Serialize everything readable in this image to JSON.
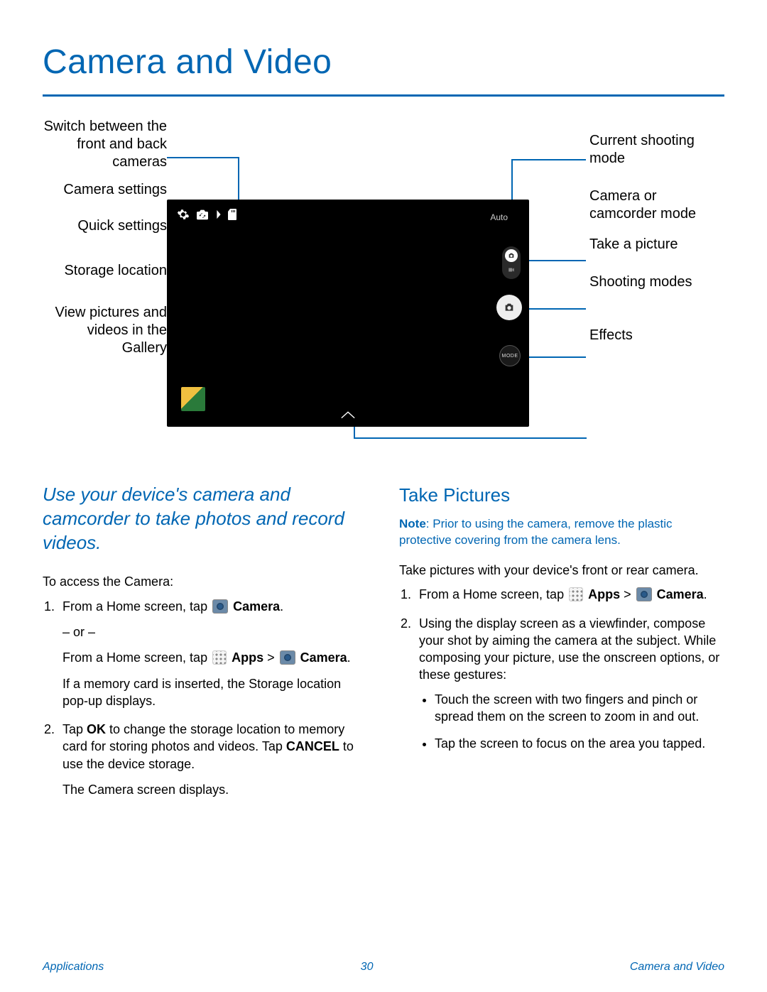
{
  "title": "Camera and Video",
  "labels_left": {
    "switch": "Switch between the front and back cameras",
    "settings": "Camera settings",
    "quick": "Quick settings",
    "storage": "Storage location",
    "gallery": "View pictures and videos in the Gallery"
  },
  "labels_right": {
    "cur_mode": "Current shooting mode",
    "cam_mode": "Camera or camcorder mode",
    "take": "Take a picture",
    "shoot": "Shooting modes",
    "effects": "Effects"
  },
  "screenshot": {
    "auto": "Auto",
    "mode_btn": "MODE"
  },
  "intro": "Use your device's camera and camcorder to take photos and record videos.",
  "access_heading": "To access the Camera:",
  "steps_left": {
    "s1a": "From a Home screen, tap ",
    "s1b": "Camera",
    "s1c": ".",
    "or": "– or –",
    "s1d": "From a Home screen, tap ",
    "s1e": "Apps",
    "s1f": " > ",
    "s1g": "Camera",
    "s1h": ".",
    "s1i": "If a memory card is inserted, the Storage location pop-up displays.",
    "s2a": "Tap ",
    "s2b": "OK",
    "s2c": " to change the storage location to memory card for storing photos and videos. Tap ",
    "s2d": "CANCEL",
    "s2e": " to use the device storage.",
    "s2f": "The Camera screen displays."
  },
  "right": {
    "heading": "Take Pictures",
    "note_label": "Note",
    "note": ": Prior to using the camera, remove the plastic protective covering from the camera lens.",
    "lead": "Take pictures with your device's front or rear camera.",
    "s1a": "From a Home screen, tap ",
    "s1b": "Apps",
    "s1c": " > ",
    "s1d": "Camera",
    "s1e": ".",
    "s2": "Using the display screen as a viewfinder, compose your shot by aiming the camera at the subject. While composing your picture, use the onscreen options, or these gestures:",
    "b1": "Touch the screen with two fingers and pinch or spread them on the screen to zoom in and out.",
    "b2": "Tap the screen to focus on the area you tapped."
  },
  "footer": {
    "left": "Applications",
    "page": "30",
    "right": "Camera and Video"
  }
}
